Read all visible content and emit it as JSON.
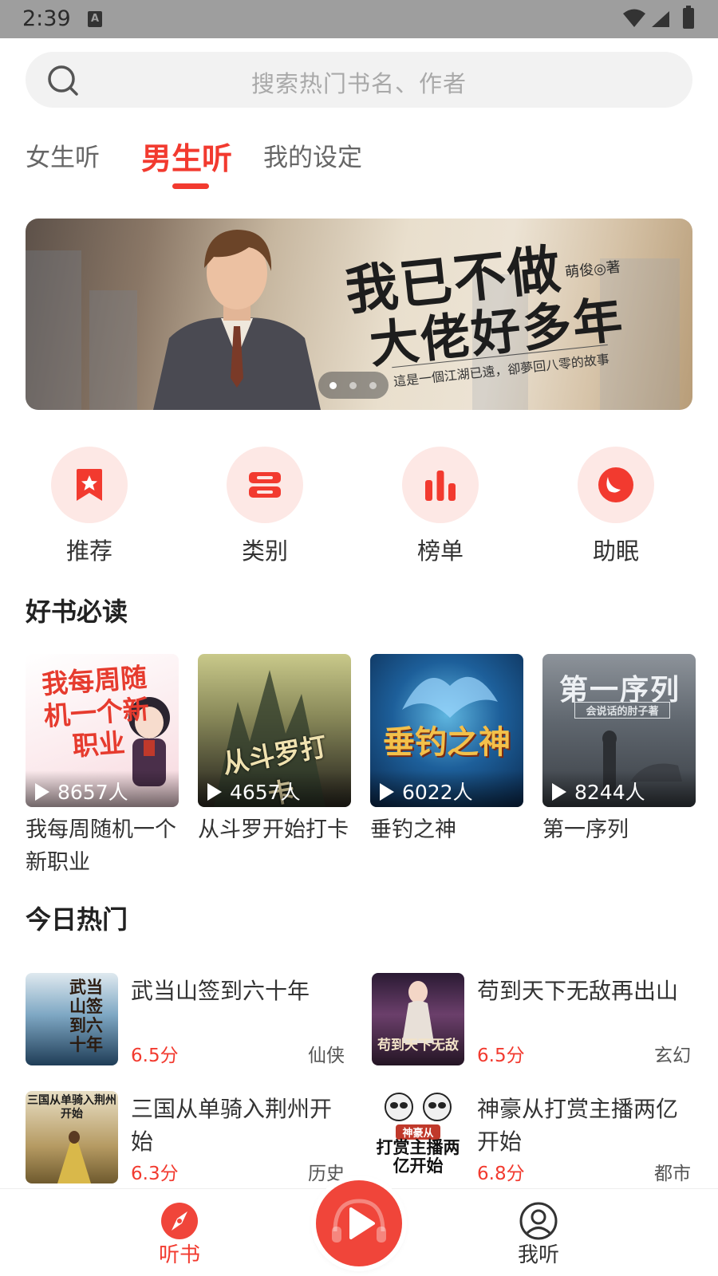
{
  "status_bar": {
    "time": "2:39",
    "notification_icon": "A"
  },
  "search": {
    "placeholder": "搜索热门书名、作者"
  },
  "tabs": [
    {
      "label": "女生听",
      "active": false
    },
    {
      "label": "男生听",
      "active": true
    },
    {
      "label": "我的设定",
      "active": false
    }
  ],
  "banner": {
    "title_line1": "我已不做",
    "title_line2": "大佬好多年",
    "author": "萌俊◎著",
    "tagline": "這是一個江湖已遠，卻夢回八零的故事",
    "page_count": 3,
    "current_page": 1
  },
  "categories": [
    {
      "label": "推荐",
      "icon": "bookmark-star-icon"
    },
    {
      "label": "类别",
      "icon": "category-list-icon"
    },
    {
      "label": "榜单",
      "icon": "bar-chart-icon"
    },
    {
      "label": "助眠",
      "icon": "moon-icon"
    }
  ],
  "must_read": {
    "title": "好书必读",
    "books": [
      {
        "title": "我每周随机一个新职业",
        "listeners": "8657人",
        "cover_text": "我每周随机一个新职业"
      },
      {
        "title": "从斗罗开始打卡",
        "listeners": "4657人",
        "cover_text": "从斗罗打卡"
      },
      {
        "title": "垂钓之神",
        "listeners": "6022人",
        "cover_text": "垂钓之神"
      },
      {
        "title": "第一序列",
        "listeners": "8244人",
        "cover_text": "第一序列",
        "cover_subtext": "会说话的肘子著"
      }
    ]
  },
  "hot_today": {
    "title": "今日热门",
    "items": [
      {
        "title": "武当山签到六十年",
        "score": "6.5分",
        "genre": "仙侠",
        "cover_text": "武当山签到六十年"
      },
      {
        "title": "苟到天下无敌再出山",
        "score": "6.5分",
        "genre": "玄幻",
        "cover_text": "苟到天下无敌"
      },
      {
        "title": "三国从单骑入荆州开始",
        "score": "6.3分",
        "genre": "历史",
        "cover_text": "三国从单骑入荆州开始"
      },
      {
        "title": "神豪从打赏主播两亿开始",
        "score": "6.8分",
        "genre": "都市",
        "cover_text": "打赏主播两亿开始",
        "cover_subtext": "神豪从"
      }
    ]
  },
  "bottom_nav": [
    {
      "label": "听书",
      "icon": "compass-icon",
      "active": true
    },
    {
      "label": "我听",
      "icon": "user-icon",
      "active": false
    }
  ],
  "colors": {
    "accent": "#f23a2f",
    "accent_light": "#fde8e5",
    "text": "#333333",
    "muted": "#666666"
  }
}
